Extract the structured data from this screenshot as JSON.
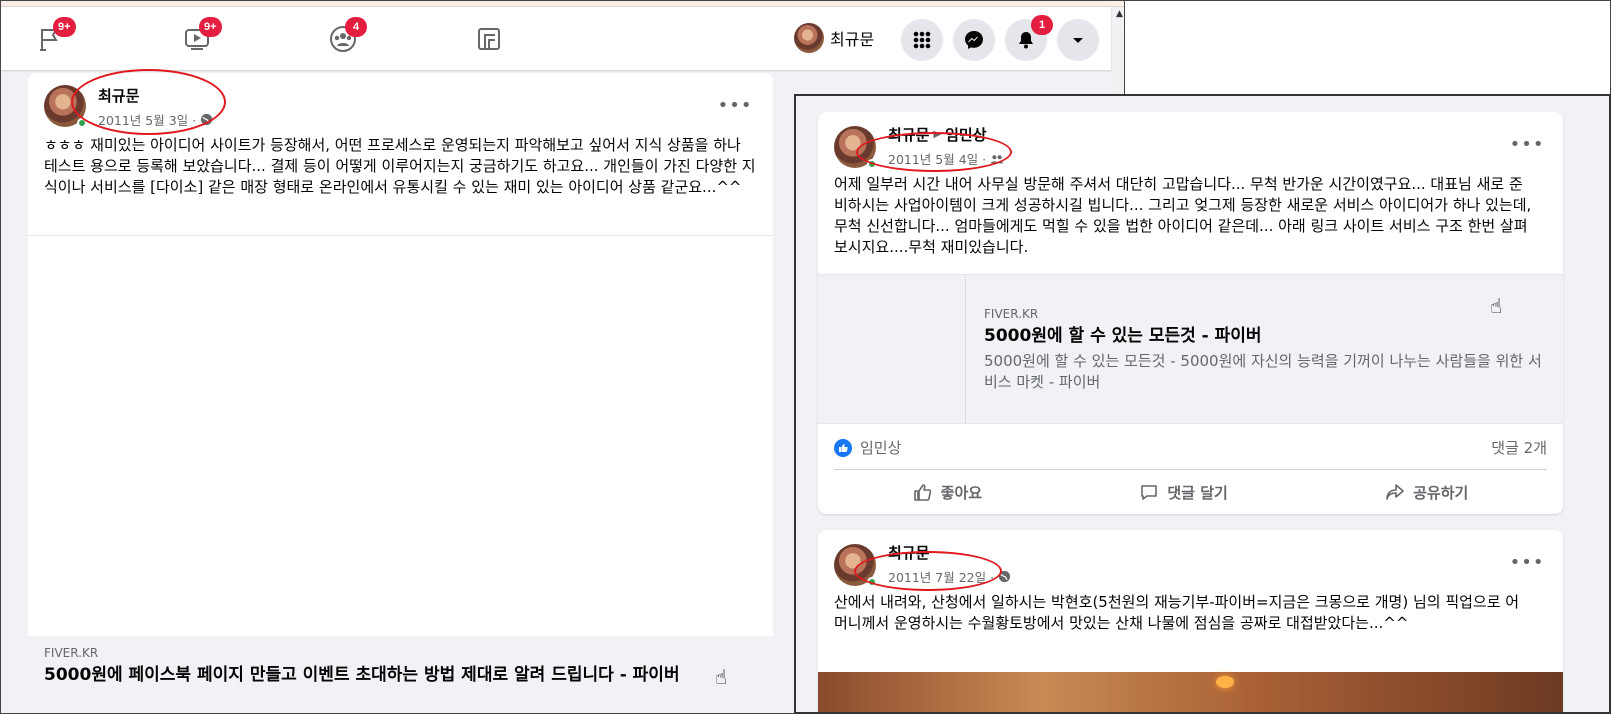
{
  "nav": {
    "tabs": [
      {
        "icon": "flag-icon",
        "badge": "9+"
      },
      {
        "icon": "watch-icon",
        "badge": "9+"
      },
      {
        "icon": "groups-icon",
        "badge": "4"
      },
      {
        "icon": "gaming-icon",
        "badge": ""
      }
    ],
    "profile_name": "최규문",
    "notifications_badge": "1"
  },
  "left_post": {
    "author": "최규문",
    "date": "2011년 5월 3일 ·",
    "privacy_icon": "globe-icon",
    "text": "ㅎㅎㅎ 재미있는 아이디어 사이트가 등장해서, 어떤 프로세스로 운영되는지 파악해보고 싶어서 지식 상품을 하나 테스트 용으로 등록해 보았습니다... 결제 등이 어떻게 이루어지는지 궁금하기도 하고요... 개인들이 가진 다양한 지식이나 서비스를 [다이소] 같은 매장 형태로 온라인에서 유통시킬 수 있는 재미 있는 아이디어 상품 같군요...^^",
    "link": {
      "domain": "FIVER.KR",
      "title": "5000원에 페이스북 페이지 만들고 이벤트 초대하는 방법 제대로 알려 드립니다 - 파이버"
    }
  },
  "right_post_1": {
    "author": "최규문",
    "target": "임민상",
    "date": "2011년 5월 4일 ·",
    "privacy_icon": "friends-icon",
    "text": "어제 일부러 시간 내어 사무실 방문해 주셔서 대단히 고맙습니다... 무척 반가운 시간이였구요... 대표님 새로 준비하시는 사업아이템이 크게 성공하시길 빕니다... 그리고 엊그제 등장한 새로운 서비스 아이디어가 하나 있는데, 무척 신선합니다... 엄마들에게도 먹힐 수 있을 법한 아이디어 같은데... 아래 링크 사이트 서비스 구조 한번 살펴보시지요....무척 재미있습니다.",
    "link": {
      "domain": "FIVER.KR",
      "title": "5000원에 할 수 있는 모든것 - 파이버",
      "description": "5000원에 할 수 있는 모든것 - 5000원에 자신의 능력을 기꺼이 나누는 사람들을 위한 서비스 마켓 - 파이버"
    },
    "reaction_name": "임민상",
    "comment_count": "댓글 2개",
    "actions": {
      "like": "좋아요",
      "comment": "댓글 달기",
      "share": "공유하기"
    }
  },
  "right_post_2": {
    "author": "최규문",
    "date": "2011년 7월 22일 ·",
    "privacy_icon": "globe-icon",
    "text": "산에서 내려와, 산청에서 일하시는 박현호(5천원의 재능기부-파이버=지금은 크몽으로 개명) 님의 픽업으로 어머니께서 운영하시는 수월황토방에서 맛있는 산채 나물에 점심을 공짜로 대접받았다는...^^"
  },
  "colors": {
    "badge": "#e41e3f",
    "online": "#31a24c",
    "annotation": "#e0191f",
    "like": "#1877f2"
  }
}
